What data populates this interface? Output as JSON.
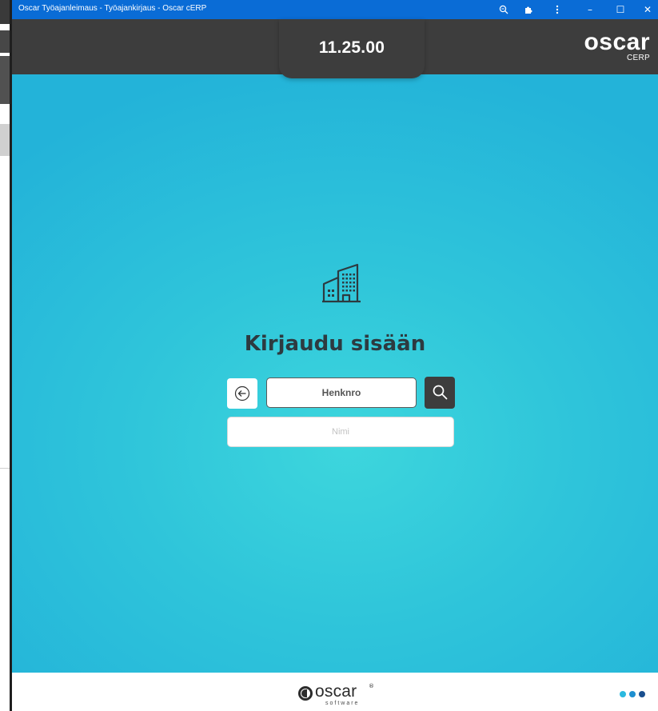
{
  "window": {
    "title": "Oscar Työajanleimaus - Työajankirjaus - Oscar cERP",
    "titlebar_color": "#0a6cd6",
    "controls": {
      "zoom_icon": "zoom-icon",
      "extensions_icon": "puzzle-icon",
      "menu_icon": "kebab-menu-icon",
      "minimize": "–",
      "maximize": "☐",
      "close": "✕"
    }
  },
  "header": {
    "time": "11.25.00",
    "brand_word": "oscar",
    "brand_sub": "CERP"
  },
  "login": {
    "icon": "building-icon",
    "title": "Kirjaudu sisään",
    "employee_number_placeholder": "Henknro",
    "name_placeholder": "Nimi",
    "back_icon": "back-arrow-icon",
    "search_icon": "search-icon"
  },
  "footer": {
    "logo_word": "oscar",
    "logo_reg": "®",
    "logo_tagline": "software",
    "dots_colors": [
      "#2bb9df",
      "#1e8fd0",
      "#1a4f8f"
    ]
  },
  "colors": {
    "header_bg": "#3d3d3d",
    "main_gradient_center": "#3dd6dd",
    "main_gradient_edge": "#23b3d9",
    "title_text": "#2d3a40"
  }
}
